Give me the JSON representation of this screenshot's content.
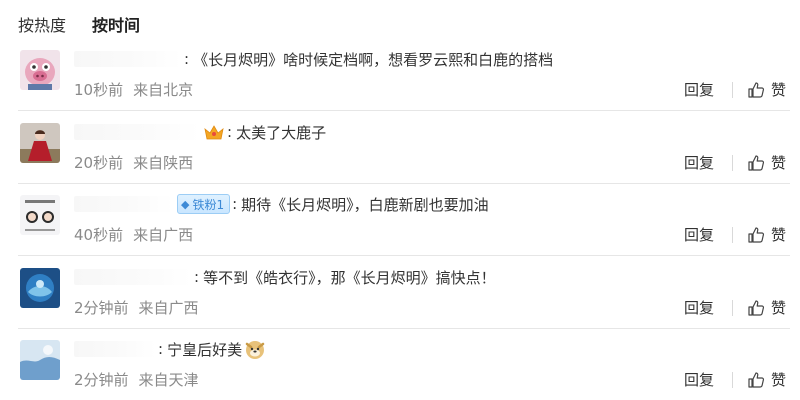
{
  "sort": {
    "hot_label": "按热度",
    "time_label": "按时间"
  },
  "actions": {
    "reply_label": "回复",
    "like_label": "赞"
  },
  "comments": [
    {
      "text": "《长月烬明》啥时候定档啊，想看罗云熙和白鹿的搭档",
      "time": "10秒前",
      "location": "来自北京"
    },
    {
      "text": "太美了大鹿子",
      "time": "20秒前",
      "location": "来自陕西"
    },
    {
      "text": "期待《长月烬明》，白鹿新剧也要加油",
      "time": "40秒前",
      "location": "来自广西",
      "badge": "铁粉1"
    },
    {
      "text": "等不到《皓衣行》，那《长月烬明》搞快点！",
      "time": "2分钟前",
      "location": "来自广西"
    },
    {
      "text": "宁皇后好美",
      "time": "2分钟前",
      "location": "来自天津"
    }
  ]
}
